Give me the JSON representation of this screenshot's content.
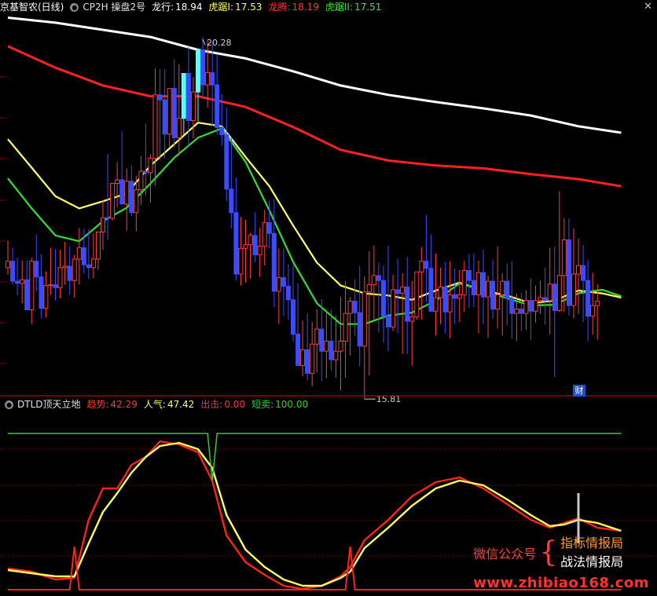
{
  "main_header": {
    "stock_name": "京基智农(日线)",
    "indicator_name": "CP2H 操盘2号",
    "items": [
      {
        "label": "龙行:",
        "value": "18.94",
        "color": "#ffffff"
      },
      {
        "label": "虎踞I:",
        "value": "17.53",
        "color": "#ffff66"
      },
      {
        "label": "龙腾:",
        "value": "18.19",
        "color": "#ff3333"
      },
      {
        "label": "虎踞II:",
        "value": "17.51",
        "color": "#33ee33"
      }
    ]
  },
  "sub_header": {
    "indicator_name": "DTLD顶天立地",
    "items": [
      {
        "label": "趋势:",
        "value": "42.29",
        "color": "#ff3333"
      },
      {
        "label": "人气:",
        "value": "47.42",
        "color": "#ffff66"
      },
      {
        "label": "出击:",
        "value": "0.00",
        "color": "#ff3333"
      },
      {
        "label": "短卖:",
        "value": "100.00",
        "color": "#33cc33"
      }
    ]
  },
  "annotations": {
    "high_label": "20.28",
    "low_label": "15.81",
    "finance_badge": "财"
  },
  "watermark": {
    "left_text": "微信公众号",
    "line1": "指标情报局",
    "line2": "战法情报局",
    "url": "www.zhibiao168.com"
  },
  "colors": {
    "up": "#ff3c3c",
    "down": "#3a4cff",
    "limit_up": "#55ffff",
    "white_line": "#ffffff",
    "red_line": "#ff2020",
    "yellow_line": "#ffff60",
    "green_line": "#30e030",
    "grid": "#7a0000",
    "separator": "#a00000"
  },
  "chart_data": [
    {
      "type": "candlestick",
      "title": "CP2H 操盘2号",
      "ylim": [
        15.3,
        20.6
      ],
      "candles": {
        "open": [
          17.05,
          17.14,
          16.86,
          16.83,
          16.88,
          16.46,
          17.14,
          16.92,
          16.48,
          16.8,
          16.81,
          16.77,
          17.05,
          17.07,
          16.87,
          17.17,
          17.33,
          17.09,
          17.05,
          17.17,
          17.55,
          17.75,
          17.74,
          18.23,
          18.28,
          17.94,
          18.26,
          17.82,
          18.14,
          18.4,
          18.38,
          18.58,
          19.47,
          19.4,
          18.92,
          19.56,
          18.87,
          19.14,
          19.77,
          19.11,
          19.51,
          20.1,
          19.61,
          19.78,
          19.61,
          19.01,
          18.91,
          18.15,
          17.82,
          16.96,
          17.32,
          17.37,
          17.5,
          17.23,
          17.35,
          17.68,
          17.53,
          16.72,
          16.91,
          16.79,
          16.6,
          16.12,
          15.68,
          15.9,
          15.57,
          15.98,
          16.19,
          15.88,
          16.02,
          15.76,
          15.88,
          16.02,
          16.41,
          16.58,
          16.42,
          15.95,
          16.71,
          16.81,
          16.94,
          16.87,
          16.37,
          16.22,
          16.74,
          16.69,
          16.78,
          16.3,
          16.36,
          16.99,
          17.14,
          17.04,
          16.44,
          16.63,
          16.78,
          16.43,
          16.67,
          16.62,
          16.67,
          17.01,
          16.87,
          16.67,
          16.98,
          16.64,
          16.86,
          16.47,
          16.67,
          16.86,
          16.62,
          16.41,
          16.47,
          16.41,
          16.59,
          16.44,
          16.59,
          16.63,
          16.59,
          16.82,
          16.45,
          16.94,
          17.44,
          16.52,
          16.96,
          17.08,
          16.87,
          16.37,
          16.52
        ],
        "high": [
          17.43,
          17.33,
          17.19,
          17.15,
          17.15,
          17.19,
          17.51,
          17.24,
          17.0,
          17.33,
          17.31,
          17.3,
          17.41,
          17.35,
          17.23,
          17.6,
          17.59,
          17.59,
          17.53,
          17.55,
          18.0,
          18.64,
          18.0,
          18.53,
          18.96,
          18.44,
          18.48,
          18.34,
          18.61,
          19.07,
          18.64,
          19.84,
          19.83,
          19.83,
          19.45,
          19.97,
          19.9,
          19.31,
          20.14,
          19.72,
          19.73,
          20.28,
          20.23,
          20.21,
          20.04,
          19.48,
          19.29,
          18.87,
          18.31,
          17.76,
          17.72,
          17.54,
          17.82,
          17.61,
          17.86,
          17.99,
          18.01,
          17.32,
          17.32,
          17.1,
          17.09,
          16.83,
          16.31,
          16.41,
          16.29,
          16.47,
          16.61,
          16.46,
          16.46,
          16.38,
          16.64,
          16.86,
          16.64,
          16.89,
          17.07,
          16.93,
          17.28,
          17.36,
          17.12,
          17.08,
          17.36,
          16.95,
          17.17,
          16.97,
          17.2,
          16.86,
          16.98,
          17.34,
          17.79,
          17.51,
          17.25,
          17.05,
          17.13,
          17.14,
          17.04,
          17.02,
          17.15,
          17.24,
          17.25,
          17.15,
          17.3,
          16.94,
          17.16,
          17.35,
          16.97,
          17.11,
          17.14,
          16.69,
          16.7,
          16.73,
          16.9,
          16.8,
          16.87,
          17.05,
          17.33,
          17.35,
          18.12,
          17.74,
          17.74,
          17.6,
          17.46,
          17.37,
          17.16,
          16.98,
          16.82
        ],
        "low": [
          16.95,
          16.81,
          16.66,
          16.55,
          16.46,
          16.26,
          16.72,
          16.34,
          16.35,
          16.67,
          16.59,
          16.62,
          16.81,
          16.67,
          16.63,
          16.81,
          16.96,
          16.89,
          16.9,
          17.02,
          17.3,
          17.44,
          17.71,
          17.9,
          17.94,
          17.57,
          17.77,
          17.56,
          17.93,
          18.06,
          17.96,
          18.2,
          18.55,
          18.58,
          18.74,
          18.73,
          18.62,
          18.92,
          18.75,
          18.86,
          19.1,
          19.43,
          19.29,
          19.03,
          18.91,
          18.76,
          17.98,
          17.6,
          16.87,
          16.8,
          16.84,
          16.9,
          17.13,
          16.92,
          17.08,
          17.32,
          16.5,
          16.26,
          16.38,
          16.32,
          16.01,
          15.74,
          15.53,
          15.47,
          15.39,
          15.58,
          15.46,
          15.5,
          15.61,
          15.51,
          15.33,
          15.51,
          15.82,
          16.09,
          15.67,
          15.21,
          15.54,
          16.32,
          16.14,
          16.0,
          15.88,
          16.16,
          16.13,
          15.84,
          15.84,
          15.68,
          16.32,
          16.32,
          16.56,
          16.45,
          16.1,
          16.26,
          16.13,
          16.06,
          16.26,
          16.29,
          16.43,
          16.49,
          16.5,
          16.13,
          16.26,
          16.07,
          16.33,
          16.2,
          16.1,
          16.24,
          16.05,
          16.02,
          16.16,
          16.18,
          16.04,
          16.28,
          16.4,
          16.25,
          16.12,
          15.52,
          16.43,
          16.43,
          16.38,
          16.34,
          16.4,
          16.29,
          16.02,
          16.11,
          16.04
        ],
        "close": [
          17.14,
          16.86,
          16.83,
          16.88,
          16.46,
          17.14,
          16.92,
          16.48,
          16.8,
          16.81,
          16.77,
          17.05,
          17.07,
          16.87,
          17.17,
          17.33,
          17.09,
          17.05,
          17.17,
          17.55,
          17.75,
          17.74,
          18.23,
          18.28,
          17.94,
          18.26,
          17.82,
          18.14,
          18.4,
          18.38,
          18.58,
          19.47,
          19.4,
          18.92,
          19.56,
          18.87,
          19.14,
          19.77,
          19.11,
          19.51,
          20.1,
          19.61,
          19.78,
          19.61,
          19.01,
          18.91,
          18.15,
          17.82,
          16.96,
          17.32,
          17.37,
          17.5,
          17.23,
          17.35,
          17.68,
          17.53,
          16.72,
          16.91,
          16.79,
          16.6,
          16.12,
          15.68,
          15.9,
          15.57,
          15.98,
          16.19,
          15.88,
          16.02,
          15.76,
          15.88,
          16.02,
          16.41,
          16.58,
          16.42,
          15.95,
          16.71,
          16.81,
          16.94,
          16.87,
          16.37,
          16.22,
          16.74,
          16.69,
          16.78,
          16.3,
          16.36,
          16.99,
          17.14,
          17.04,
          16.44,
          16.63,
          16.78,
          16.43,
          16.67,
          16.62,
          16.67,
          17.01,
          16.87,
          16.67,
          16.98,
          16.64,
          16.86,
          16.47,
          16.67,
          16.86,
          16.62,
          16.41,
          16.47,
          16.41,
          16.59,
          16.44,
          16.59,
          16.63,
          16.59,
          16.82,
          16.45,
          16.94,
          17.44,
          16.52,
          16.96,
          17.08,
          16.87,
          16.37,
          16.52,
          16.58
        ],
        "limit_up_days": [
          37,
          40
        ]
      },
      "series": [
        {
          "name": "龙行",
          "color": "#ffffff",
          "x": [
            0,
            10,
            20,
            30,
            40,
            50,
            60,
            70,
            80,
            90,
            100,
            110,
            120,
            129
          ],
          "y": [
            20.55,
            20.48,
            20.38,
            20.28,
            20.1,
            19.98,
            19.8,
            19.6,
            19.47,
            19.37,
            19.28,
            19.18,
            19.03,
            18.94
          ]
        },
        {
          "name": "龙腾",
          "color": "#ff2020",
          "x": [
            0,
            10,
            20,
            30,
            40,
            50,
            60,
            70,
            80,
            90,
            100,
            110,
            120,
            129
          ],
          "y": [
            20.15,
            19.85,
            19.6,
            19.45,
            19.45,
            19.3,
            19.02,
            18.7,
            18.55,
            18.48,
            18.44,
            18.36,
            18.29,
            18.19
          ]
        },
        {
          "name": "虎踞I",
          "color": "#ffff60",
          "x": [
            0,
            5,
            10,
            15,
            20,
            25,
            30,
            35,
            40,
            45,
            50,
            55,
            60,
            65,
            70,
            75,
            80,
            85,
            90,
            95,
            100,
            105,
            110,
            115,
            120,
            125,
            129
          ],
          "y": [
            18.85,
            18.45,
            18.05,
            17.88,
            17.98,
            18.09,
            18.48,
            18.78,
            19.08,
            19.03,
            18.6,
            18.19,
            17.64,
            17.12,
            16.8,
            16.69,
            16.66,
            16.6,
            16.73,
            16.84,
            16.73,
            16.66,
            16.55,
            16.59,
            16.73,
            16.69,
            16.63
          ]
        },
        {
          "name": "虎踞II",
          "color": "#30e030",
          "x": [
            0,
            5,
            10,
            15,
            20,
            25,
            30,
            35,
            40,
            45,
            50,
            55,
            60,
            65,
            70,
            75,
            80,
            85,
            90,
            95,
            100,
            105,
            110,
            115,
            120,
            125,
            129
          ],
          "y": [
            18.3,
            17.88,
            17.5,
            17.42,
            17.7,
            17.89,
            18.23,
            18.59,
            18.87,
            19.0,
            18.53,
            17.85,
            17.13,
            16.55,
            16.26,
            16.26,
            16.38,
            16.42,
            16.59,
            16.83,
            16.73,
            16.62,
            16.52,
            16.53,
            16.69,
            16.74,
            16.65
          ]
        }
      ]
    },
    {
      "type": "line",
      "title": "DTLD顶天立地",
      "ylim": [
        0,
        100
      ],
      "x_count": 130,
      "series": [
        {
          "name": "趋势",
          "color": "#ff2020",
          "x": [
            0,
            5,
            10,
            14,
            17,
            20,
            23,
            26,
            29,
            32,
            36,
            40,
            43,
            46,
            50,
            54,
            58,
            62,
            66,
            70,
            72,
            75,
            80,
            85,
            90,
            95,
            100,
            105,
            110,
            114,
            117,
            120,
            124,
            129
          ],
          "y": [
            14,
            12,
            7,
            8,
            45,
            65,
            65,
            80,
            85,
            95,
            93,
            88,
            70,
            35,
            18,
            10,
            3,
            1,
            3,
            9,
            15,
            32,
            45,
            60,
            69,
            72,
            65,
            55,
            45,
            40,
            43,
            46,
            40,
            38
          ]
        },
        {
          "name": "人气",
          "color": "#ffff60",
          "x": [
            0,
            5,
            10,
            14,
            17,
            20,
            23,
            26,
            29,
            32,
            36,
            40,
            43,
            46,
            50,
            54,
            58,
            62,
            66,
            70,
            72,
            75,
            80,
            85,
            90,
            95,
            100,
            105,
            110,
            114,
            117,
            120,
            124,
            129
          ],
          "y": [
            13,
            11,
            9,
            9,
            30,
            50,
            62,
            75,
            85,
            92,
            94,
            90,
            78,
            48,
            26,
            15,
            7,
            3,
            3,
            8,
            12,
            27,
            40,
            54,
            65,
            70,
            67,
            58,
            48,
            41,
            42,
            45,
            43,
            38
          ]
        },
        {
          "name": "出击",
          "color": "#ff2020",
          "baseline": 0,
          "spikes_at": [
            14,
            72
          ],
          "spike_height": 28
        },
        {
          "name": "短卖",
          "color": "#33cc33",
          "baseline": 100,
          "dips_at": [
            43
          ],
          "dip_value": 70
        },
        {
          "name": "vertical_marker",
          "color": "#c8c8c8",
          "x": 120,
          "range": [
            30,
            62
          ]
        }
      ]
    }
  ]
}
